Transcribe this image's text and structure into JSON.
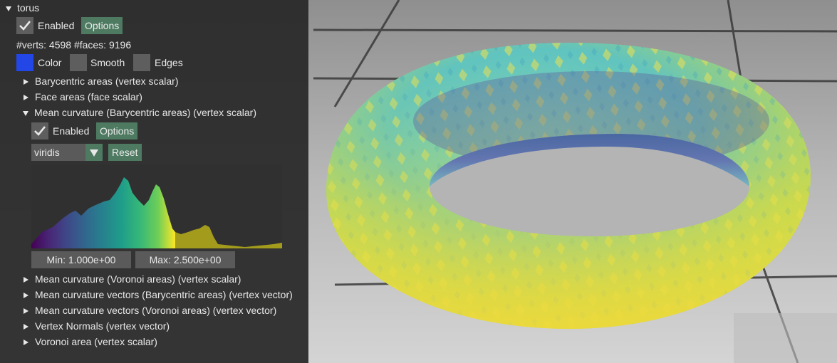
{
  "object": {
    "name": "torus"
  },
  "mesh": {
    "enabled_label": "Enabled",
    "options_label": "Options",
    "stats": "#verts: 4598  #faces: 9196",
    "color_label": "Color",
    "color_value": "#2346e6",
    "smooth_label": "Smooth",
    "edges_label": "Edges"
  },
  "quantities": [
    {
      "label": "Barycentric areas (vertex scalar)"
    },
    {
      "label": "Face areas (face scalar)"
    },
    {
      "label": "Mean curvature (Barycentric areas) (vertex scalar)"
    },
    {
      "label": "Mean curvature (Voronoi areas) (vertex scalar)"
    },
    {
      "label": "Mean curvature vectors (Barycentric areas) (vertex vector)"
    },
    {
      "label": "Mean curvature vectors (Voronoi areas) (vertex vector)"
    },
    {
      "label": "Vertex Normals (vertex vector)"
    },
    {
      "label": "Voronoi area (vertex scalar)"
    }
  ],
  "expanded": {
    "enabled_label": "Enabled",
    "options_label": "Options",
    "colormap": "viridis",
    "reset_label": "Reset",
    "min_label": "Min: 1.000e+00",
    "max_label": "Max: 2.500e+00"
  },
  "colors": {
    "accent": "#4d7a61",
    "panel": "#282828"
  }
}
